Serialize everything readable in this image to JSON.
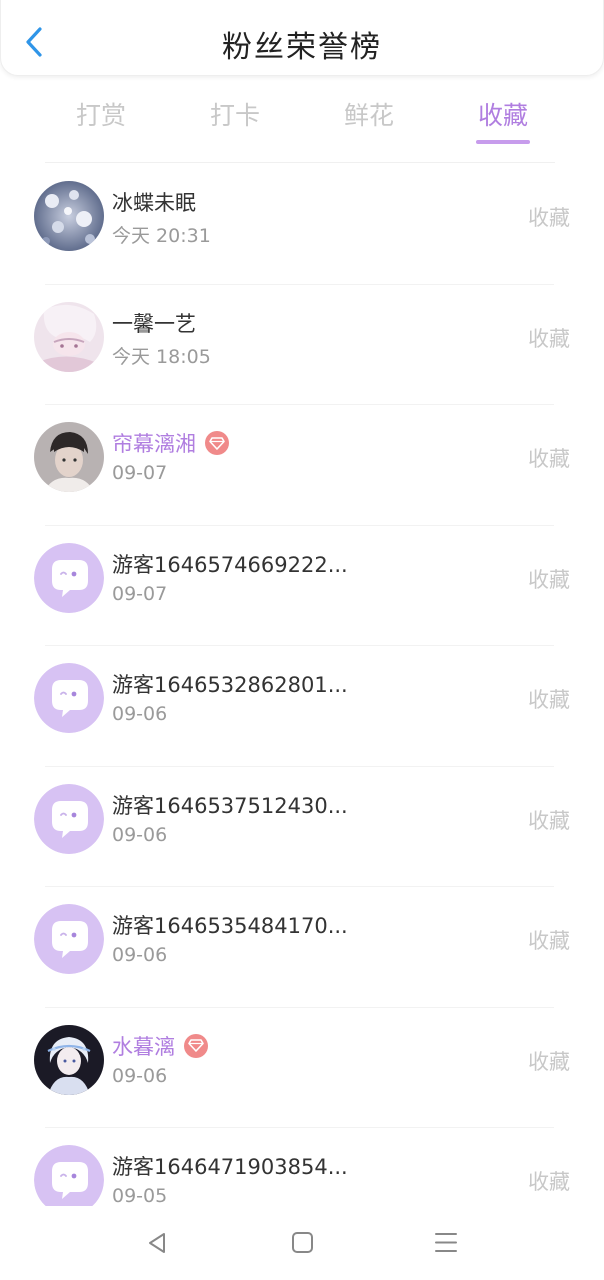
{
  "header": {
    "title": "粉丝荣誉榜"
  },
  "tabs": [
    {
      "label": "打赏",
      "active": false
    },
    {
      "label": "打卡",
      "active": false
    },
    {
      "label": "鲜花",
      "active": false
    },
    {
      "label": "收藏",
      "active": true
    }
  ],
  "rows": [
    {
      "name": "冰蝶未眠",
      "time": "今天 20:31",
      "action": "收藏",
      "avatar": "photo-blue-flowers",
      "vip": false
    },
    {
      "name": "一馨一艺",
      "time": "今天 18:05",
      "action": "收藏",
      "avatar": "photo-anime-pink",
      "vip": false
    },
    {
      "name": "帘幕漓湘",
      "time": "09-07",
      "action": "收藏",
      "avatar": "photo-person",
      "vip": true
    },
    {
      "name": "游客1646574669222...",
      "time": "09-07",
      "action": "收藏",
      "avatar": "default-chat-bubble",
      "vip": false
    },
    {
      "name": "游客1646532862801...",
      "time": "09-06",
      "action": "收藏",
      "avatar": "default-chat-bubble",
      "vip": false
    },
    {
      "name": "游客1646537512430...",
      "time": "09-06",
      "action": "收藏",
      "avatar": "default-chat-bubble",
      "vip": false
    },
    {
      "name": "游客1646535484170...",
      "time": "09-06",
      "action": "收藏",
      "avatar": "default-chat-bubble",
      "vip": false
    },
    {
      "name": "水暮漓",
      "time": "09-06",
      "action": "收藏",
      "avatar": "photo-anime-dark",
      "vip": true
    },
    {
      "name": "游客1646471903854...",
      "time": "09-05",
      "action": "收藏",
      "avatar": "default-chat-bubble",
      "vip": false
    }
  ],
  "colors": {
    "accent": "#b07ee0",
    "back_arrow": "#2f95e8",
    "vip_badge": "#f08a8a",
    "default_avatar": "#d7c2f3"
  },
  "icons": {
    "back": "chevron-left-icon",
    "vip": "diamond-badge-icon",
    "nav_back": "triangle-back-icon",
    "nav_home": "square-home-icon",
    "nav_menu": "menu-lines-icon"
  }
}
